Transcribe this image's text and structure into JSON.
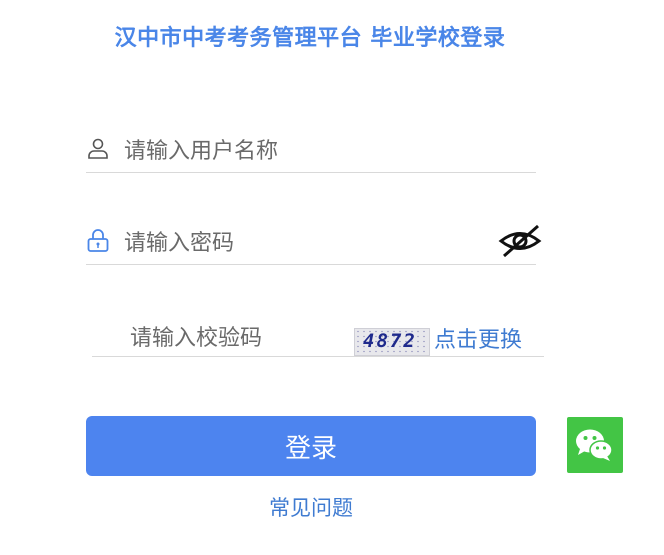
{
  "header": {
    "title": "汉中市中考考务管理平台 毕业学校登录"
  },
  "form": {
    "username_placeholder": "请输入用户名称",
    "password_placeholder": "请输入密码",
    "captcha_placeholder": "请输入校验码",
    "captcha_code": "4872",
    "refresh_label": "点击更换",
    "login_label": "登录"
  },
  "footer": {
    "faq_label": "常见问题"
  },
  "icons": {
    "user": "user-icon",
    "lock": "lock-icon",
    "eye": "eye-slash-icon",
    "wechat": "wechat-icon"
  },
  "colors": {
    "accent": "#4a86e8",
    "button": "#4d84ef",
    "link": "#3f7bd1",
    "wechat": "#43c545"
  }
}
